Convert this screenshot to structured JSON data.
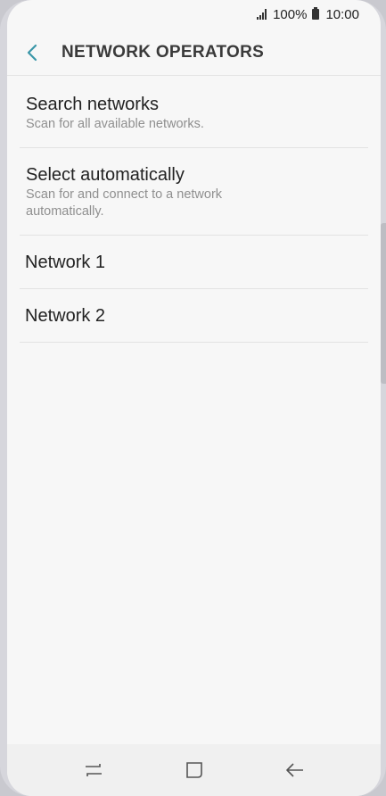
{
  "status_bar": {
    "battery": "100%",
    "time": "10:00"
  },
  "header": {
    "title": "NETWORK OPERATORS",
    "back_icon": "chevron-left-icon"
  },
  "list": {
    "items": [
      {
        "title": "Search networks",
        "subtitle": "Scan for all available networks."
      },
      {
        "title": "Select automatically",
        "subtitle": "Scan for and connect to a network automatically."
      },
      {
        "title": "Network 1"
      },
      {
        "title": "Network 2"
      }
    ]
  },
  "nav_bar": {
    "recents_icon": "recents-icon",
    "home_icon": "home-icon",
    "back_icon": "back-arrow-icon"
  },
  "colors": {
    "accent": "#3a96a8",
    "background": "#f7f7f7",
    "title_text": "#3a3a3a"
  }
}
